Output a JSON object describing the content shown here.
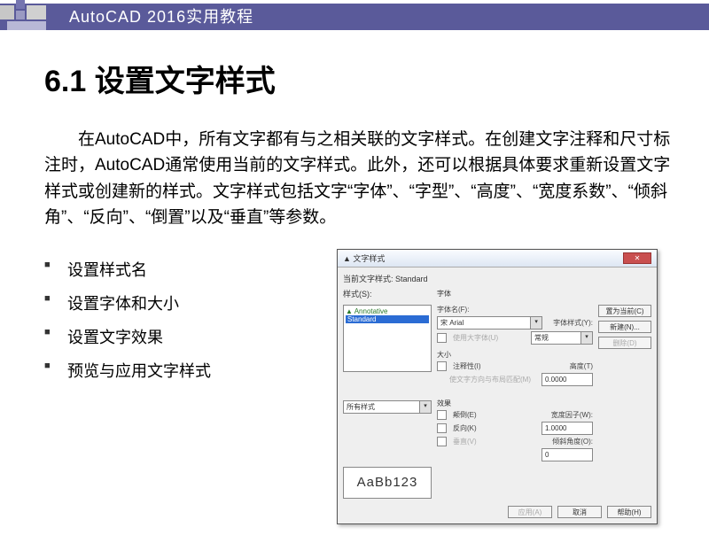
{
  "banner": {
    "title": "AutoCAD 2016实用教程"
  },
  "heading": "6.1  设置文字样式",
  "paragraph": "在AutoCAD中，所有文字都有与之相关联的文字样式。在创建文字注释和尺寸标注时，AutoCAD通常使用当前的文字样式。此外，还可以根据具体要求重新设置文字样式或创建新的样式。文字样式包括文字“字体”、“字型”、“高度”、“宽度系数”、“倾斜角”、“反向”、“倒置”以及“垂直”等参数。",
  "bullets": [
    "设置样式名",
    "设置字体和大小",
    "设置文字效果",
    "预览与应用文字样式"
  ],
  "dialog": {
    "title": "文字样式",
    "current_label": "当前文字样式: Standard",
    "styles_label": "样式(S):",
    "styles": [
      "Annotative",
      "Standard"
    ],
    "font_group": "字体",
    "font_name_label": "字体名(F):",
    "font_name_value": "宋 Arial",
    "font_style_label": "字体样式(Y):",
    "font_style_value": "常规",
    "use_bigfont": "使用大字体(U)",
    "size_group": "大小",
    "annotative_label": "注释性(I)",
    "match_orient": "使文字方向与布局匹配(M)",
    "height_label": "高度(T)",
    "height_value": "0.0000",
    "allstyles_label": "所有样式",
    "effects_group": "效果",
    "upside_down": "颠倒(E)",
    "backwards": "反向(K)",
    "vertical": "垂直(V)",
    "width_factor_label": "宽度因子(W):",
    "width_factor_value": "1.0000",
    "oblique_label": "倾斜角度(O):",
    "oblique_value": "0",
    "preview_text": "AaBb123",
    "btn_set_current": "置为当前(C)",
    "btn_new": "新建(N)...",
    "btn_delete": "删除(D)",
    "btn_apply": "应用(A)",
    "btn_cancel": "取消",
    "btn_help": "帮助(H)"
  }
}
